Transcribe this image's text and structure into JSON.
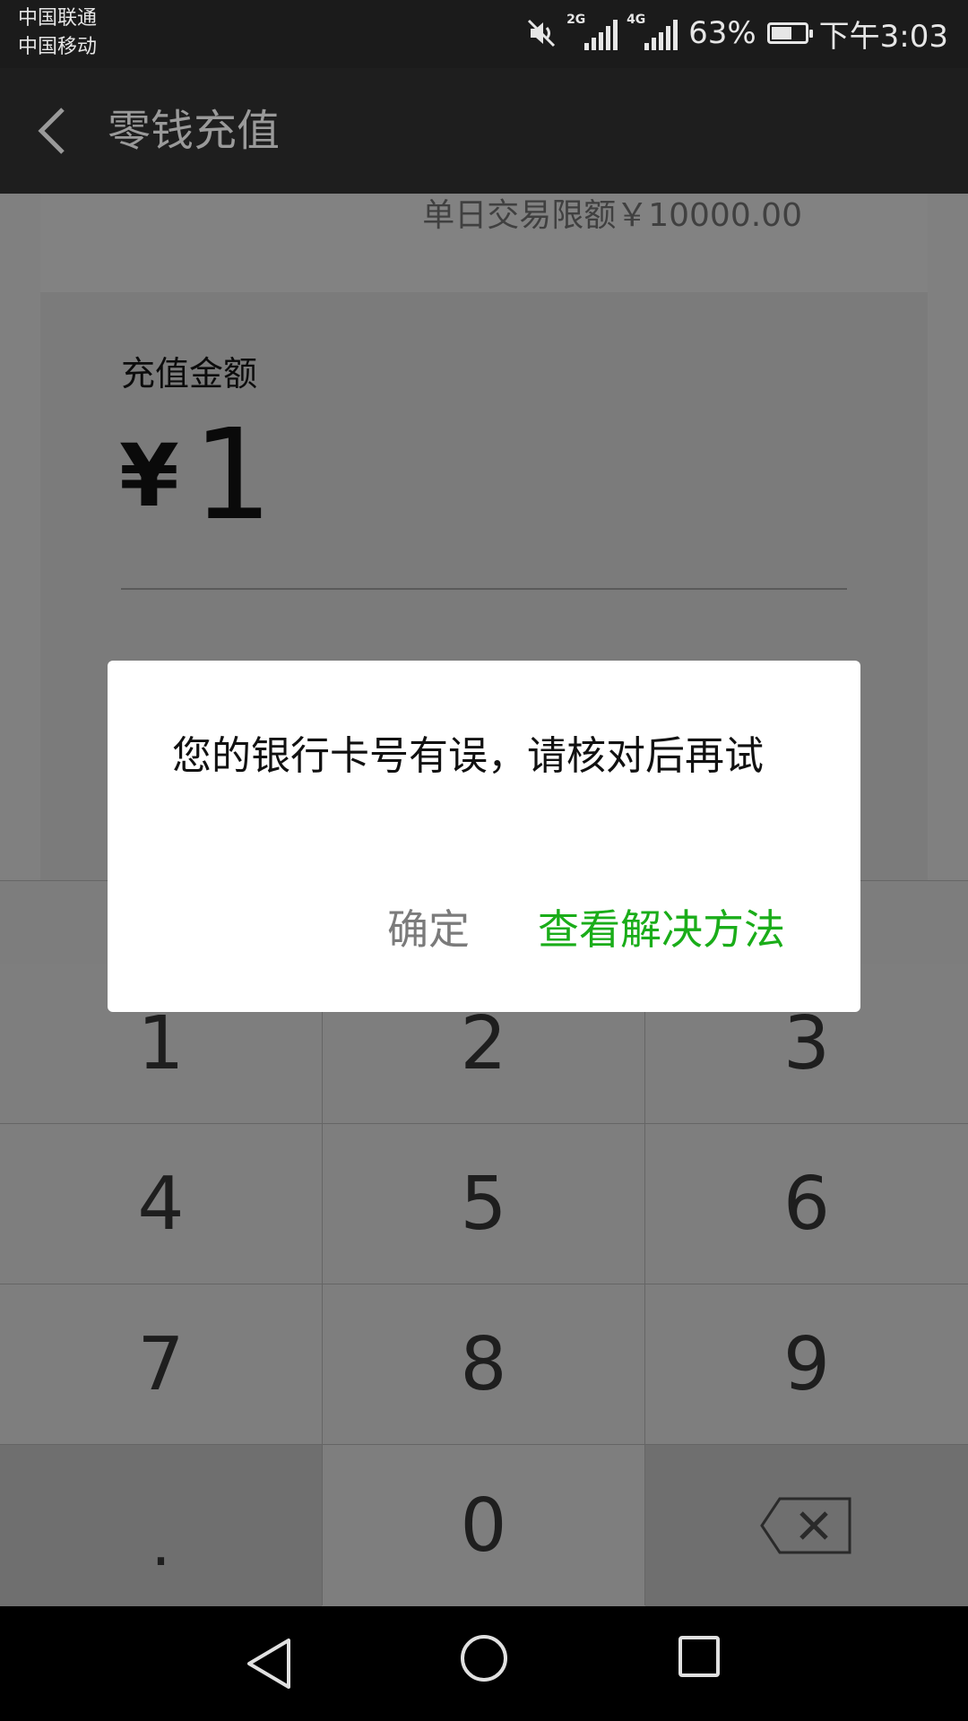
{
  "status_bar": {
    "carrier_1": "中国联通",
    "carrier_2": "中国移动",
    "network_1": "2G",
    "network_2": "4G",
    "battery_percent": "63%",
    "battery_level": 0.63,
    "time": "下午3:03"
  },
  "action_bar": {
    "title": "零钱充值"
  },
  "card": {
    "limit_text": "单日交易限额￥10000.00",
    "amount_label": "充值金额",
    "currency_symbol": "¥",
    "amount_value": "1"
  },
  "keypad": {
    "keys": [
      "1",
      "2",
      "3",
      "4",
      "5",
      "6",
      "7",
      "8",
      "9",
      ".",
      "0"
    ]
  },
  "dialog": {
    "message": "您的银行卡号有误，请核对后再试",
    "confirm_label": "确定",
    "solution_label": "查看解决方法"
  },
  "colors": {
    "accent_green": "#1aad19"
  }
}
